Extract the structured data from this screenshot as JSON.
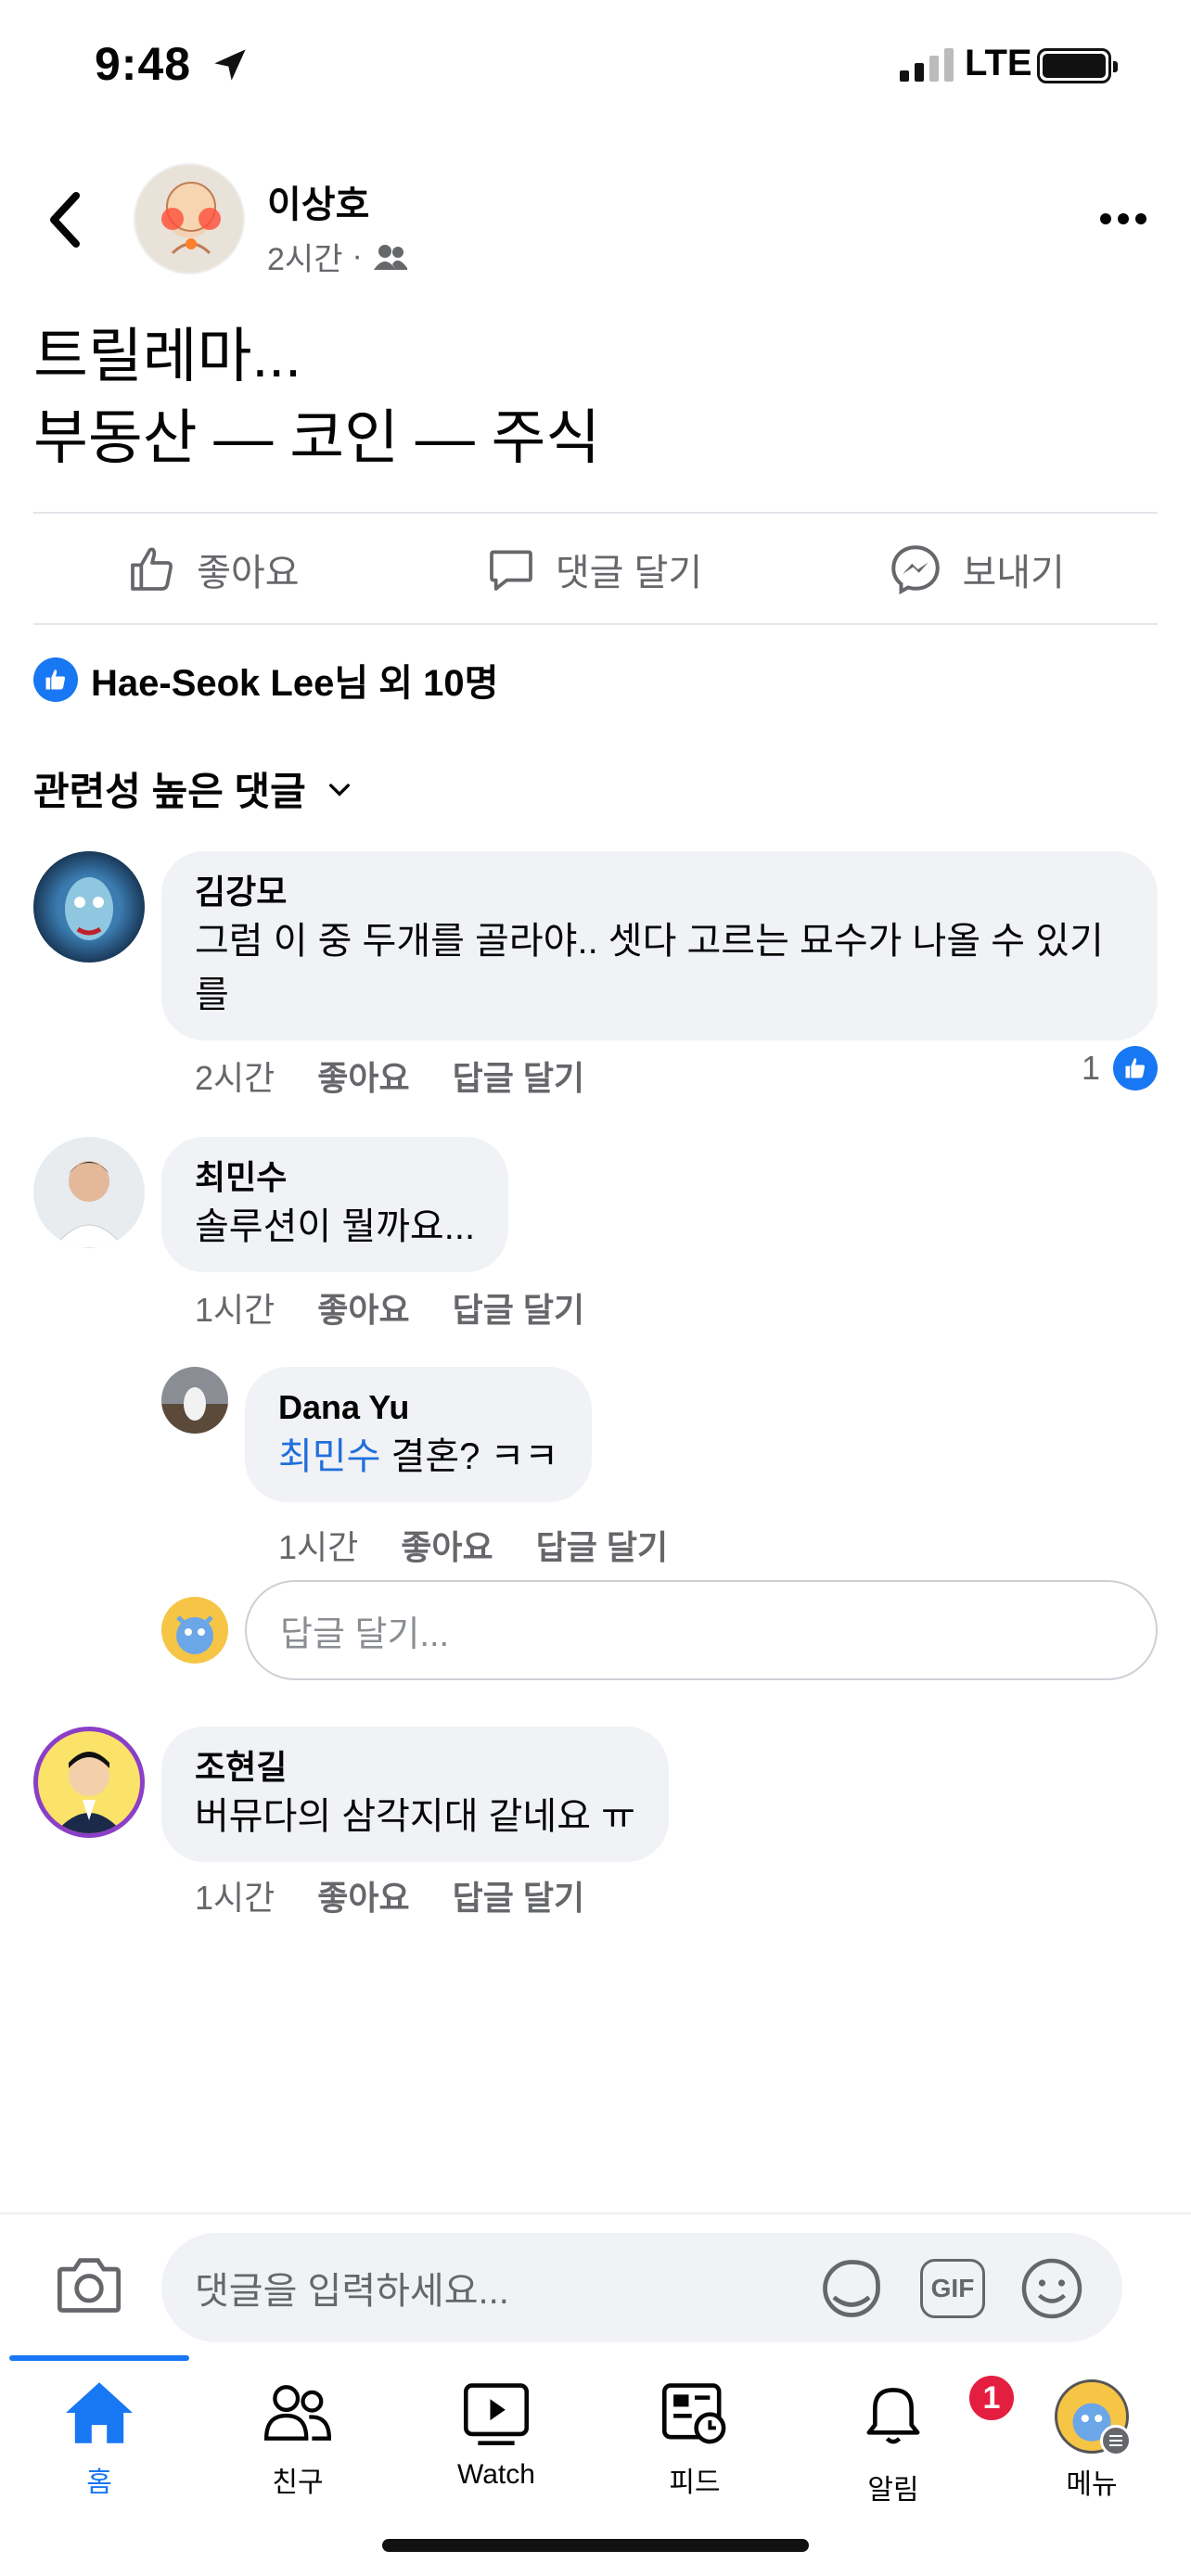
{
  "status": {
    "time": "9:48",
    "network": "LTE"
  },
  "post": {
    "author": "이상호",
    "time": "2시간",
    "separator": "·",
    "text": "트릴레마...\n부동산 — 코인 — 주식",
    "actions": {
      "like": "좋아요",
      "comment": "댓글 달기",
      "send": "보내기"
    },
    "reactions": "Hae-Seok Lee님 외 10명"
  },
  "sort_label": "관련성 높은 댓글",
  "comments": [
    {
      "author": "김강모",
      "text": "그럼 이 중 두개를 골라야.. 셋다 고르는 묘수가 나올 수 있기를",
      "time": "2시간",
      "like": "좋아요",
      "reply": "답글 달기",
      "like_count": "1"
    },
    {
      "author": "최민수",
      "text": "솔루션이 뭘까요...",
      "time": "1시간",
      "like": "좋아요",
      "reply": "답글 달기"
    },
    {
      "author": "Dana Yu",
      "mention": "최민수",
      "text": " 결혼? ㅋㅋ",
      "time": "1시간",
      "like": "좋아요",
      "reply": "답글 달기"
    },
    {
      "author": "조현길",
      "text": "버뮤다의 삼각지대 같네요 ㅠ",
      "time": "1시간",
      "like": "좋아요",
      "reply": "답글 달기"
    }
  ],
  "reply_placeholder": "답글 달기...",
  "composer_placeholder": "댓글을 입력하세요...",
  "gif_label": "GIF",
  "tabs": [
    {
      "label": "홈",
      "icon": "home-icon"
    },
    {
      "label": "친구",
      "icon": "friends-icon"
    },
    {
      "label": "Watch",
      "icon": "watch-icon"
    },
    {
      "label": "피드",
      "icon": "feed-icon"
    },
    {
      "label": "알림",
      "icon": "bell-icon",
      "badge": "1"
    },
    {
      "label": "메뉴",
      "icon": "menu-avatar"
    }
  ],
  "colors": {
    "accent": "#1877f2",
    "badge": "#e41e3f",
    "bubble": "#f0f2f5"
  }
}
